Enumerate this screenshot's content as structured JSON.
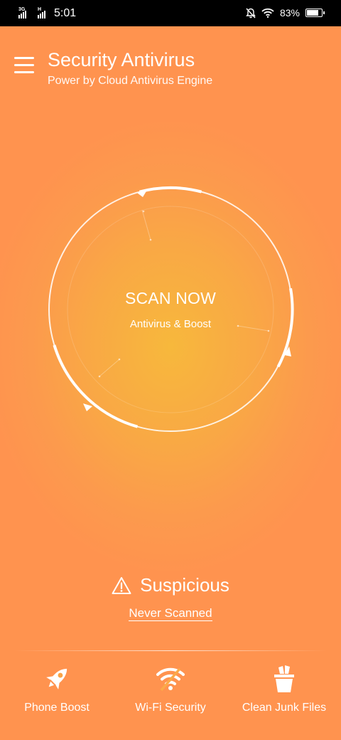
{
  "status_bar": {
    "net1": "3G",
    "net2": "H",
    "time": "5:01",
    "battery": "83%",
    "battery_level": 0.83
  },
  "header": {
    "title": "Security Antivirus",
    "subtitle": "Power by Cloud Antivirus Engine"
  },
  "scan": {
    "label": "SCAN NOW",
    "sublabel": "Antivirus & Boost"
  },
  "status": {
    "text": "Suspicious",
    "link": "Never Scanned"
  },
  "bottom_nav": {
    "items": [
      {
        "label": "Phone Boost",
        "icon": "rocket-icon"
      },
      {
        "label": "Wi-Fi Security",
        "icon": "wifi-icon"
      },
      {
        "label": "Clean Junk Files",
        "icon": "trash-icon"
      }
    ]
  },
  "colors": {
    "background_center": "#f7b83c",
    "background_edge": "#ff934f",
    "foreground": "#ffffff",
    "status_bar": "#000000"
  }
}
